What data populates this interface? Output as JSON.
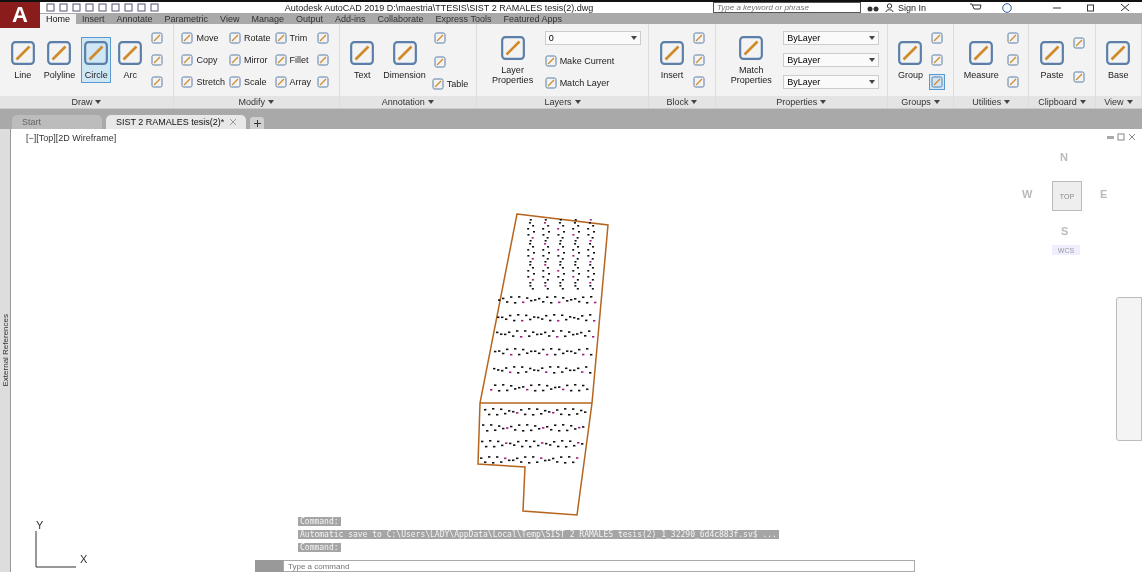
{
  "title_bar": {
    "app_letter": "A",
    "title": "Autodesk AutoCAD 2019   D:\\maestria\\TTESIS\\SIST 2 RAMALES tesis(2).dwg",
    "search_placeholder": "Type a keyword or phrase",
    "sign_in": "Sign In"
  },
  "ribbon_tabs": [
    {
      "label": "Home",
      "selected": true
    },
    {
      "label": "Insert",
      "selected": false
    },
    {
      "label": "Annotate",
      "selected": false
    },
    {
      "label": "Parametric",
      "selected": false
    },
    {
      "label": "View",
      "selected": false
    },
    {
      "label": "Manage",
      "selected": false
    },
    {
      "label": "Output",
      "selected": false
    },
    {
      "label": "Add-ins",
      "selected": false
    },
    {
      "label": "Collaborate",
      "selected": false
    },
    {
      "label": "Express Tools",
      "selected": false
    },
    {
      "label": "Featured Apps",
      "selected": false
    }
  ],
  "panels": [
    {
      "title": "Draw",
      "columns": [
        [
          {
            "kind": "large",
            "label": "Line",
            "selected": false
          }
        ],
        [
          {
            "kind": "large",
            "label": "Polyline",
            "selected": false
          }
        ],
        [
          {
            "kind": "large",
            "label": "Circle",
            "selected": true
          }
        ],
        [
          {
            "kind": "large",
            "label": "Arc",
            "selected": false
          }
        ],
        [
          {
            "kind": "icon",
            "selected": false
          },
          {
            "kind": "icon",
            "selected": false
          },
          {
            "kind": "icon",
            "selected": false
          }
        ]
      ]
    },
    {
      "title": "Modify",
      "columns": [
        [
          {
            "kind": "small",
            "label": "Move",
            "selected": false
          },
          {
            "kind": "small",
            "label": "Copy",
            "selected": false
          },
          {
            "kind": "small",
            "label": "Stretch",
            "selected": false
          }
        ],
        [
          {
            "kind": "small",
            "label": "Rotate",
            "selected": false
          },
          {
            "kind": "small",
            "label": "Mirror",
            "selected": false
          },
          {
            "kind": "small",
            "label": "Scale",
            "selected": false
          }
        ],
        [
          {
            "kind": "small",
            "label": "Trim",
            "selected": false
          },
          {
            "kind": "small",
            "label": "Fillet",
            "selected": false
          },
          {
            "kind": "small",
            "label": "Array",
            "selected": false
          }
        ],
        [
          {
            "kind": "icon",
            "selected": false
          },
          {
            "kind": "icon",
            "selected": false
          },
          {
            "kind": "icon",
            "selected": false
          }
        ]
      ]
    },
    {
      "title": "Annotation",
      "columns": [
        [
          {
            "kind": "large",
            "label": "Text",
            "selected": false
          }
        ],
        [
          {
            "kind": "large",
            "label": "Dimension",
            "selected": false
          }
        ],
        [
          {
            "kind": "icon",
            "selected": false
          },
          {
            "kind": "icon",
            "selected": false
          },
          {
            "kind": "small",
            "label": "Table",
            "selected": false
          }
        ]
      ]
    },
    {
      "title": "Layers",
      "columns": [
        [
          {
            "kind": "large",
            "label": "Layer Properties",
            "selected": false
          }
        ],
        [
          {
            "kind": "dropdown",
            "label": "0",
            "selected": false
          },
          {
            "kind": "small",
            "label": "Make Current",
            "selected": false
          },
          {
            "kind": "small",
            "label": "Match Layer",
            "selected": false
          }
        ]
      ]
    },
    {
      "title": "Block",
      "columns": [
        [
          {
            "kind": "large",
            "label": "Insert",
            "selected": false
          }
        ],
        [
          {
            "kind": "icon",
            "selected": false
          },
          {
            "kind": "icon",
            "selected": false
          },
          {
            "kind": "icon",
            "selected": false
          }
        ]
      ]
    },
    {
      "title": "Properties",
      "columns": [
        [
          {
            "kind": "large",
            "label": "Match Properties",
            "selected": false
          }
        ],
        [
          {
            "kind": "dropdown",
            "label": "ByLayer",
            "selected": false
          },
          {
            "kind": "dropdown",
            "label": "ByLayer",
            "selected": false
          },
          {
            "kind": "dropdown",
            "label": "ByLayer",
            "selected": false
          }
        ]
      ]
    },
    {
      "title": "Groups",
      "columns": [
        [
          {
            "kind": "large",
            "label": "Group",
            "selected": false
          }
        ],
        [
          {
            "kind": "icon",
            "selected": false
          },
          {
            "kind": "icon",
            "selected": false
          },
          {
            "kind": "icon",
            "selected": true
          }
        ]
      ]
    },
    {
      "title": "Utilities",
      "columns": [
        [
          {
            "kind": "large",
            "label": "Measure",
            "selected": false
          }
        ],
        [
          {
            "kind": "icon",
            "selected": false
          },
          {
            "kind": "icon",
            "selected": false
          },
          {
            "kind": "icon",
            "selected": false
          }
        ]
      ]
    },
    {
      "title": "Clipboard",
      "columns": [
        [
          {
            "kind": "large",
            "label": "Paste",
            "selected": false
          }
        ],
        [
          {
            "kind": "icon",
            "selected": false
          },
          {
            "kind": "icon",
            "selected": false
          }
        ]
      ]
    },
    {
      "title": "View",
      "columns": [
        [
          {
            "kind": "large",
            "label": "Base",
            "selected": false
          }
        ]
      ]
    }
  ],
  "doc_tabs": [
    {
      "label": "Start",
      "selected": false
    },
    {
      "label": "SIST 2 RAMALES tesis(2)*",
      "selected": true
    }
  ],
  "viewport_label": "[−][Top][2D Wireframe]",
  "side_palette": "External References",
  "viewcube": {
    "north": "N",
    "west": "W",
    "top": "TOP",
    "east": "E",
    "south": "S",
    "wcs": "WCS"
  },
  "ucs": {
    "y": "Y",
    "x": "X"
  },
  "command_history": [
    "Command:",
    "Automatic save to C:\\Users\\LADY\\AppData\\Local\\Temp\\SIST 2 RAMALES tesis(2)_1_32290_6d4c883f.sv$ ...",
    "Command:"
  ],
  "command_placeholder": "Type a command"
}
